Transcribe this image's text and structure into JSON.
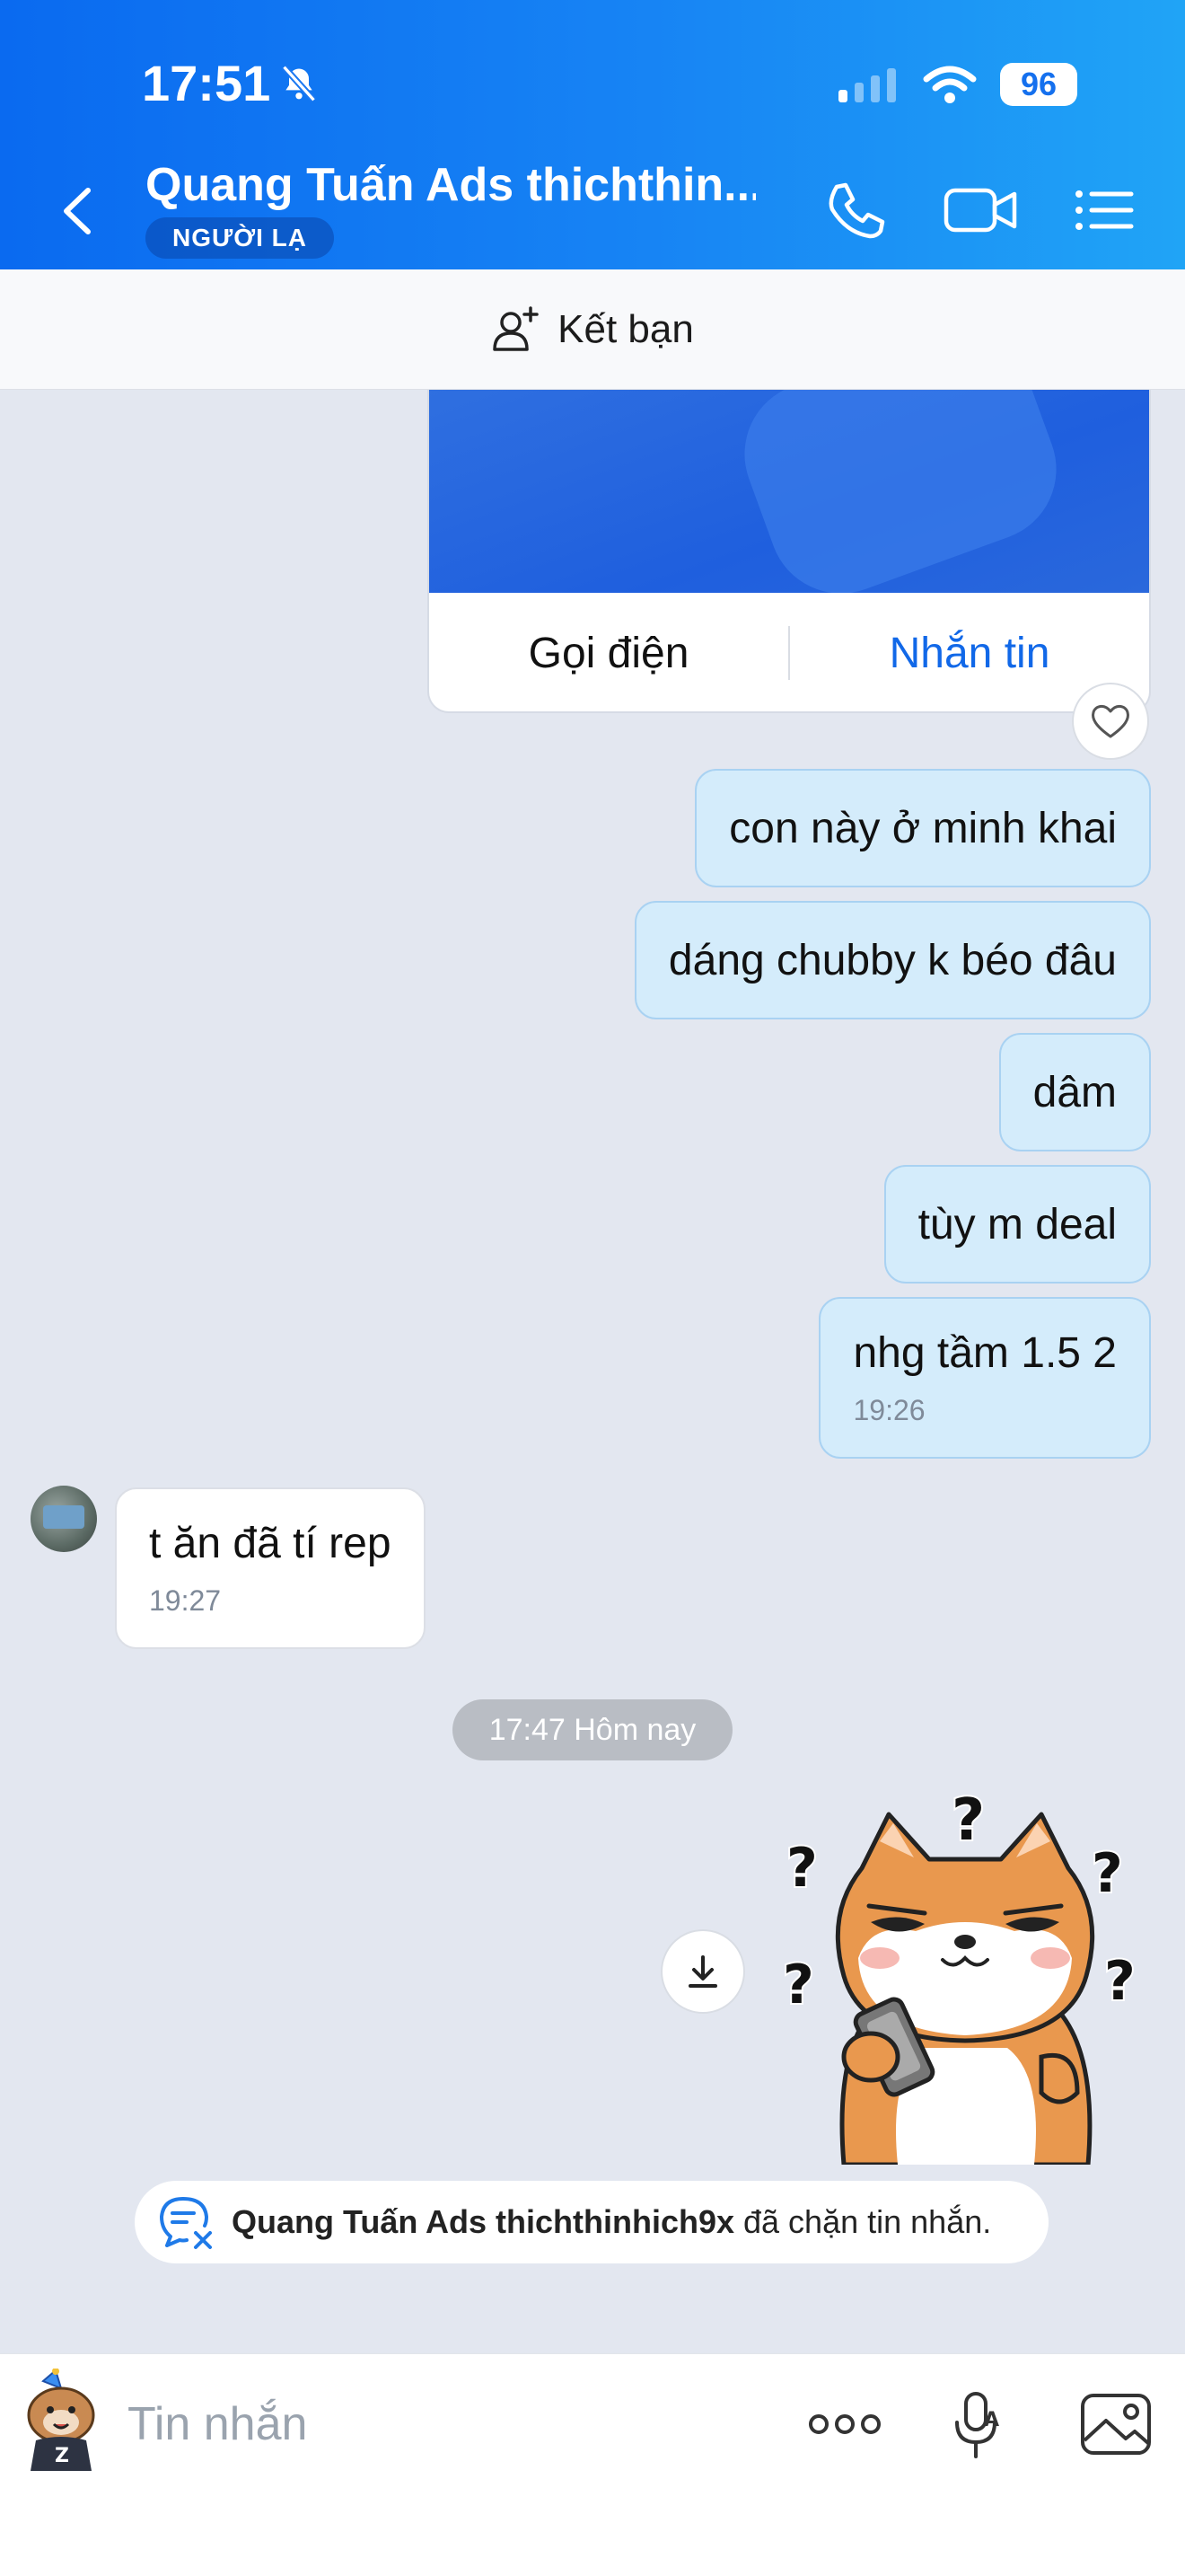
{
  "status_bar": {
    "time": "17:51",
    "battery": "96"
  },
  "header": {
    "title": "Quang Tuấn Ads thichthin...",
    "badge": "NGƯỜI LẠ",
    "colors": {
      "gradient_start": "#0a6af0",
      "gradient_end": "#20a4f6"
    },
    "icons": [
      "back-chevron-icon",
      "phone-icon",
      "video-call-icon",
      "menu-list-icon"
    ]
  },
  "friend_bar": {
    "label": "Kết bạn"
  },
  "contact_card": {
    "call_label": "Gọi điện",
    "message_label": "Nhắn tin"
  },
  "messages": [
    {
      "direction": "out",
      "text": "con này ở minh khai"
    },
    {
      "direction": "out",
      "text": "dáng chubby k béo đâu"
    },
    {
      "direction": "out",
      "text": "dâm"
    },
    {
      "direction": "out",
      "text": "tùy m deal"
    },
    {
      "direction": "out",
      "text": "nhg tầm 1.5 2",
      "time": "19:26"
    },
    {
      "direction": "in",
      "text": "t ăn đã tí rep",
      "time": "19:27"
    }
  ],
  "date_separator": "17:47 Hôm nay",
  "block_notice": {
    "name": "Quang Tuấn Ads thichthinhich9x",
    "text": "đã chặn tin nhắn."
  },
  "composer": {
    "placeholder": "Tin nhắn"
  },
  "colors": {
    "accent": "#1168e8",
    "outgoing_bubble": "#d4ecfb",
    "chat_background": "#e3e7f0"
  }
}
